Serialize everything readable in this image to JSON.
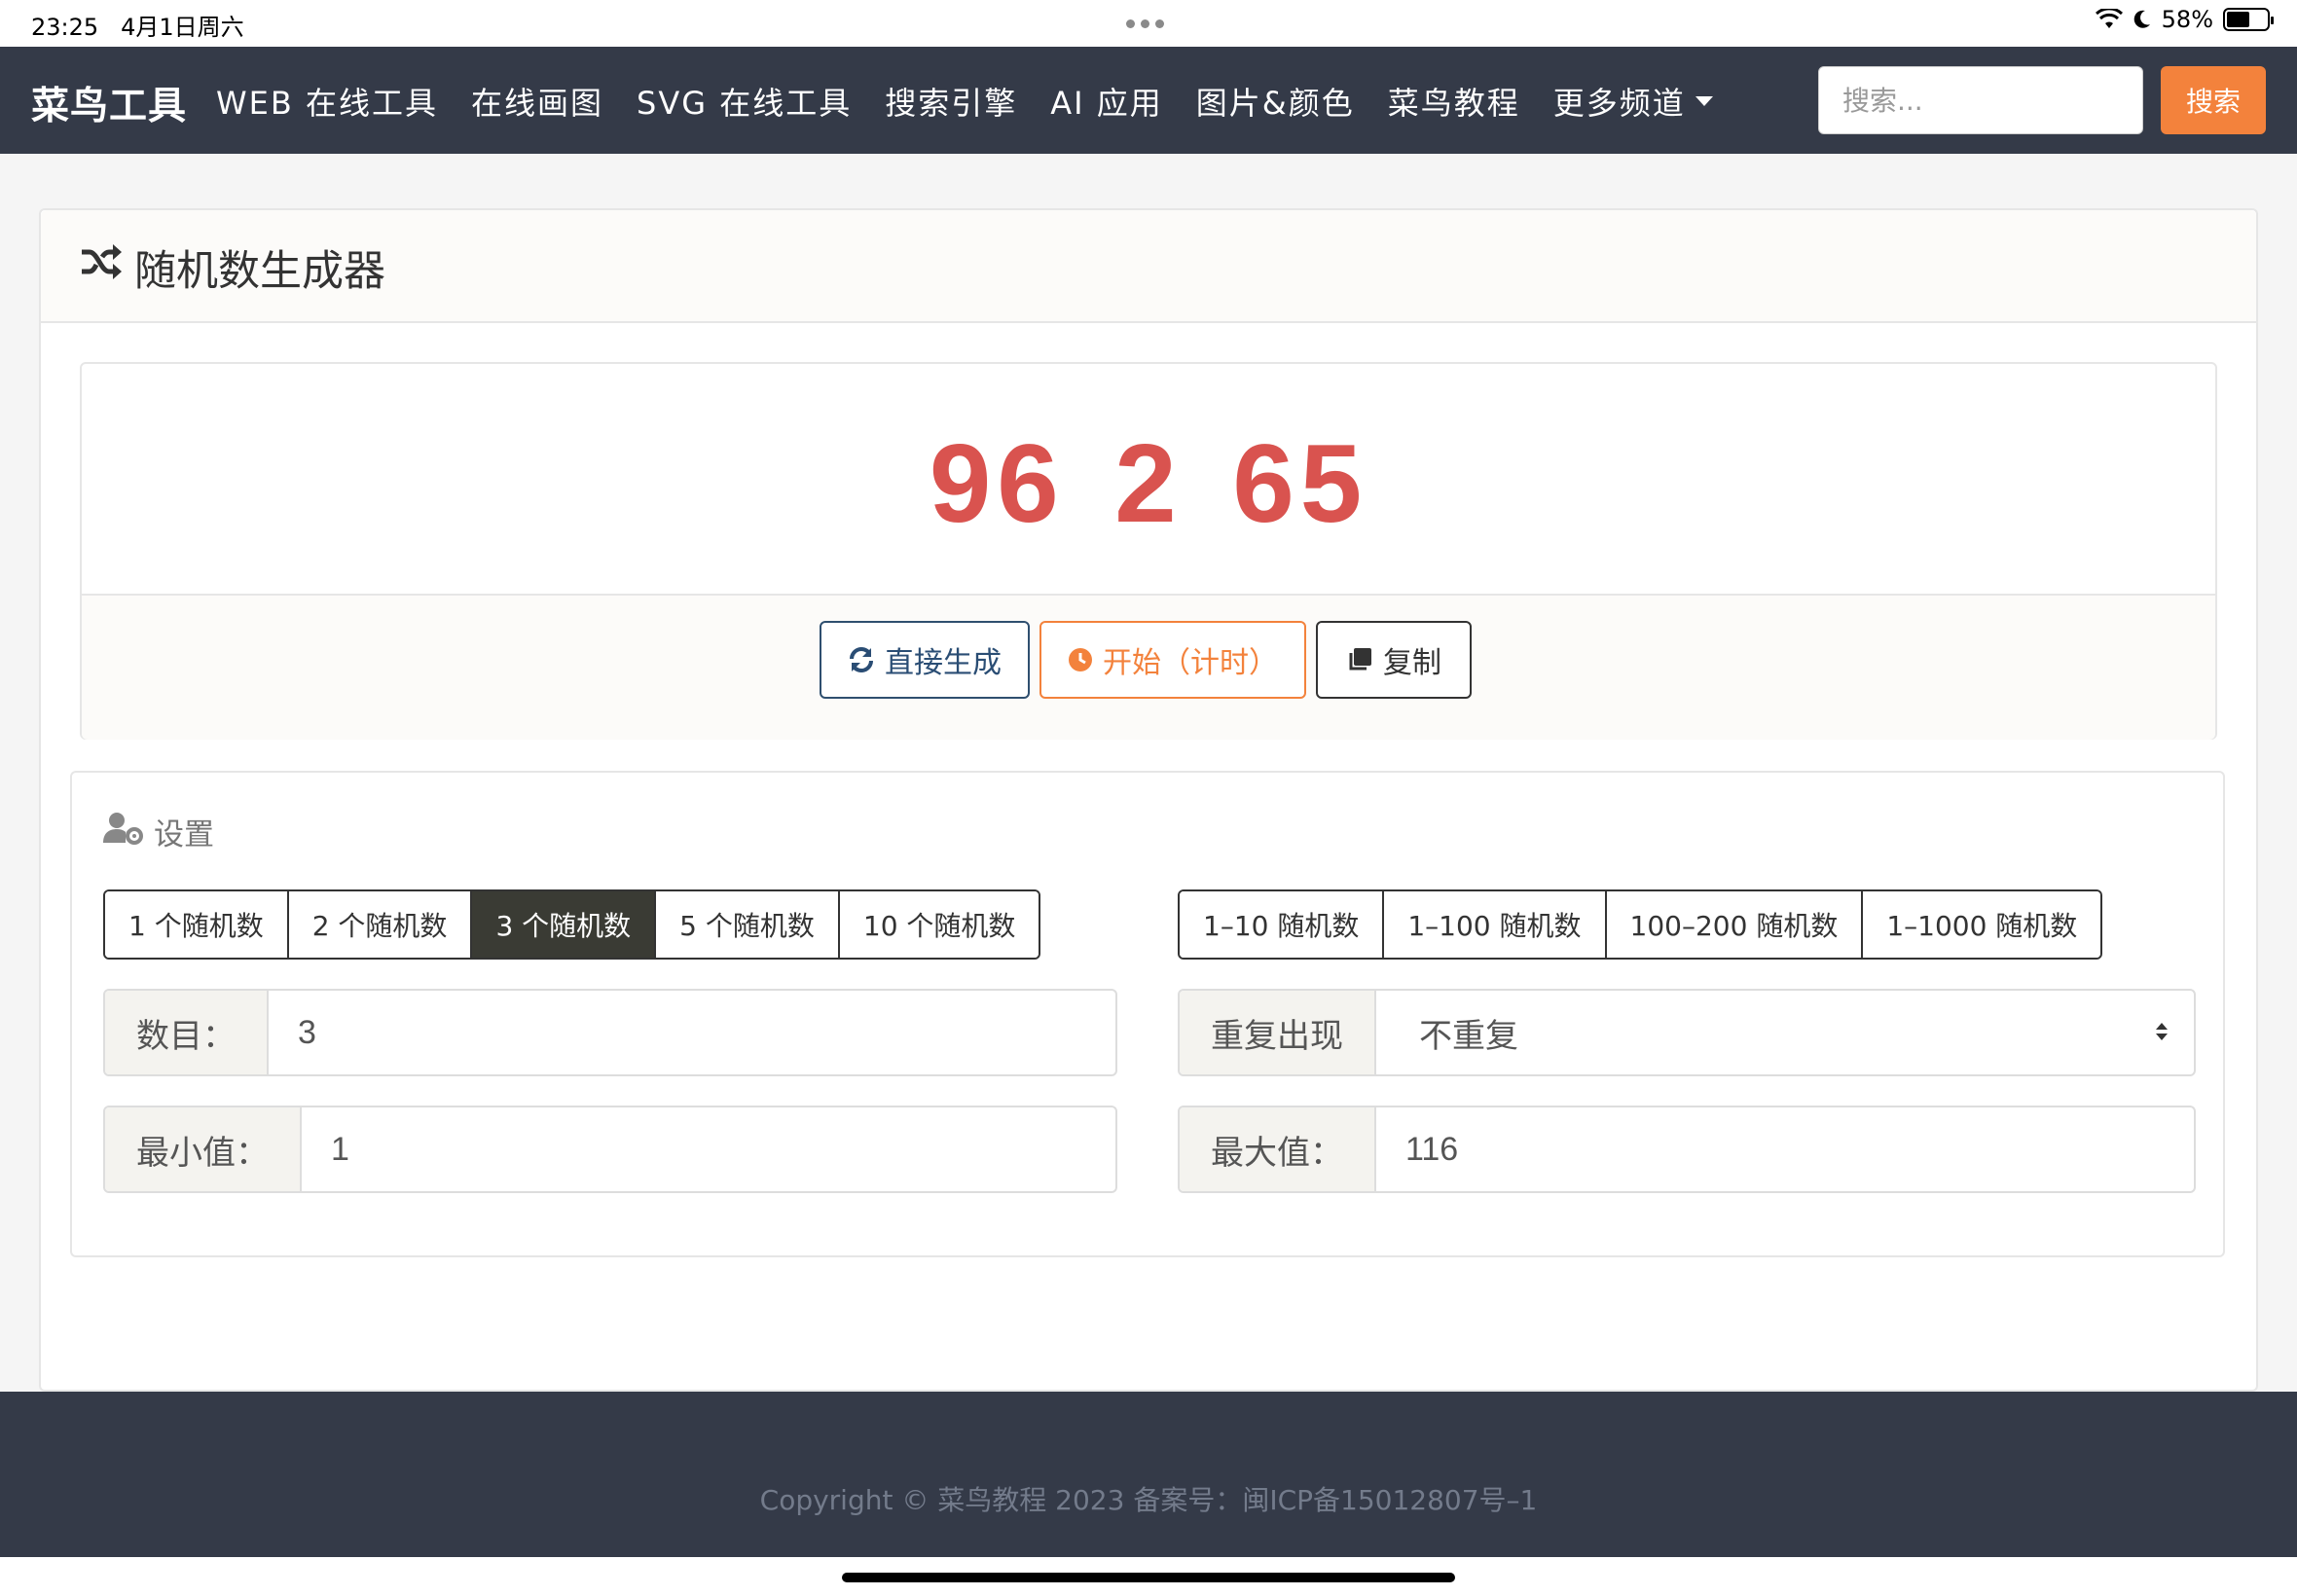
{
  "status_bar": {
    "time": "23:25",
    "date": "4月1日周六",
    "battery": "58%",
    "battery_level": 0.58
  },
  "navbar": {
    "brand": "菜鸟工具",
    "items": [
      {
        "label": "WEB 在线工具"
      },
      {
        "label": "在线画图"
      },
      {
        "label": "SVG 在线工具"
      },
      {
        "label": "搜索引擎"
      },
      {
        "label": "AI 应用"
      },
      {
        "label": "图片&颜色"
      },
      {
        "label": "菜鸟教程"
      },
      {
        "label": "更多频道"
      }
    ],
    "search_placeholder": "搜索...",
    "search_button": "搜索"
  },
  "card": {
    "title": "随机数生成器"
  },
  "result": {
    "value": "96 2 65",
    "color": "#d9534f"
  },
  "actions": {
    "generate": "直接生成",
    "start": "开始（计时）",
    "copy": "复制"
  },
  "settings": {
    "title": "设置",
    "count_presets": [
      "1 个随机数",
      "2 个随机数",
      "3 个随机数",
      "5 个随机数",
      "10 个随机数"
    ],
    "active_count_preset": 2,
    "range_presets": [
      "1–10 随机数",
      "1–100 随机数",
      "100–200 随机数",
      "1–1000 随机数"
    ],
    "count_label": "数目：",
    "count_value": "3",
    "repeat_label": "重复出现",
    "repeat_value": "不重复",
    "min_label": "最小值：",
    "min_value": "1",
    "max_label": "最大值：",
    "max_value": "116"
  },
  "footer": {
    "text": "Copyright © 菜鸟教程 2023 备案号：闽ICP备15012807号–1"
  },
  "colors": {
    "navbar": "#343a48",
    "accent": "#f3823c",
    "primary": "#2a4d74"
  }
}
